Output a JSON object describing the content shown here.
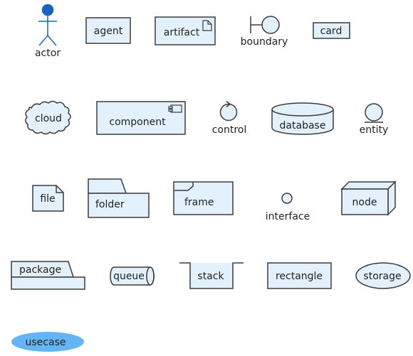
{
  "diagram": {
    "type": "PlantUML element showcase",
    "colors": {
      "fill": "#E3F1FC",
      "stroke": "#3C3C3C",
      "text": "#222222",
      "actor": "#1565C0",
      "usecase_fill": "#64B5F6"
    },
    "elements": {
      "actor": "actor",
      "agent": "agent",
      "artifact": "artifact",
      "boundary": "boundary",
      "card": "card",
      "cloud": "cloud",
      "component": "component",
      "control": "control",
      "database": "database",
      "entity": "entity",
      "file": "file",
      "folder": "folder",
      "frame": "frame",
      "interface": "interface",
      "node": "node",
      "package": "package",
      "queue": "queue",
      "stack": "stack",
      "rectangle": "rectangle",
      "storage": "storage",
      "usecase": "usecase"
    }
  }
}
